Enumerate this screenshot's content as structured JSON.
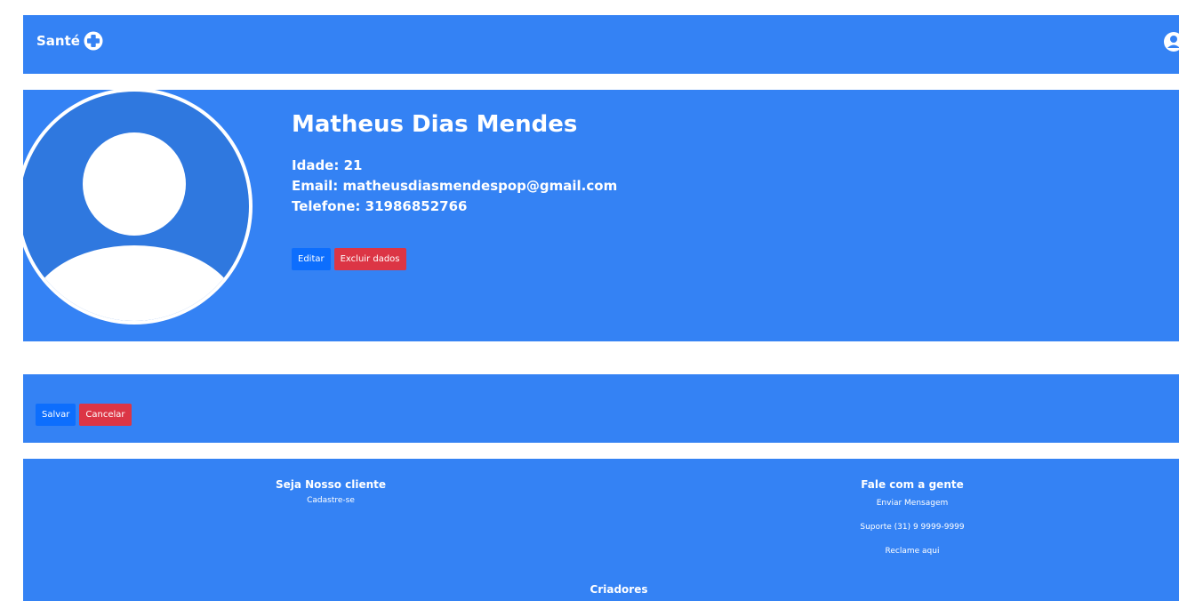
{
  "navbar": {
    "brand": "Santé",
    "brand_icon": "plus-circle-icon",
    "user_icon": "user-circle-icon"
  },
  "profile": {
    "name": "Matheus Dias Mendes",
    "age_line": "Idade: 21",
    "email_line": "Email: matheusdiasmendespop@gmail.com",
    "phone_line": "Telefone: 31986852766",
    "edit_label": "Editar",
    "delete_label": "Excluir dados"
  },
  "actions": {
    "save_label": "Salvar",
    "cancel_label": "Cancelar"
  },
  "footer": {
    "left_title": "Seja Nosso cliente",
    "left_link": "Cadastre-se",
    "right_title": "Fale com a gente",
    "right_links": [
      "Enviar Mensagem",
      "Suporte (31) 9 9999-9999",
      "Reclame aqui"
    ],
    "bottom_title": "Criadores"
  },
  "colors": {
    "primary_bg": "#3482f4",
    "button_primary": "#0d6efd",
    "button_danger": "#dc3545",
    "avatar_fill": "#2f78df"
  }
}
